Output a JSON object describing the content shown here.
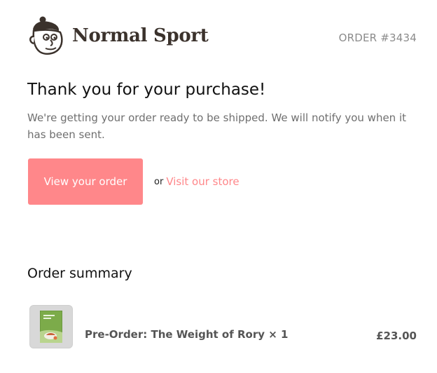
{
  "header": {
    "brand_name": "Normal Sport",
    "order_label": "ORDER #3434"
  },
  "main": {
    "title": "Thank you for your purchase!",
    "message": "We're getting your order ready to be shipped. We will notify you when it has been sent.",
    "view_order_label": "View your order",
    "or_text": "or",
    "visit_store_label": "Visit our store"
  },
  "summary": {
    "title": "Order summary",
    "items": [
      {
        "name": "Pre-Order: The Weight of Rory × 1",
        "price": "£23.00",
        "thumbnail": "book-cover"
      }
    ]
  },
  "colors": {
    "accent": "#ff878a",
    "brand_text": "#3b322c",
    "muted_text": "#6f6f6f"
  }
}
